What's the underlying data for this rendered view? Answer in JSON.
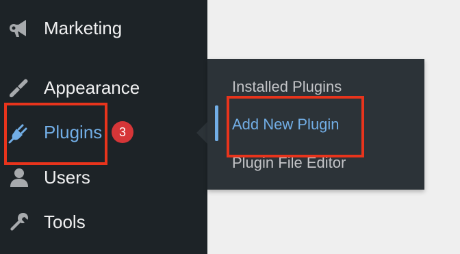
{
  "sidebar": {
    "items": [
      {
        "label": "Marketing",
        "icon": "megaphone-icon"
      },
      {
        "label": "Appearance",
        "icon": "paintbrush-icon"
      },
      {
        "label": "Plugins",
        "icon": "plugin-plug-icon",
        "badge": "3",
        "active": true
      },
      {
        "label": "Users",
        "icon": "user-icon"
      },
      {
        "label": "Tools",
        "icon": "wrench-icon"
      }
    ]
  },
  "submenu": {
    "items": [
      {
        "label": "Installed Plugins"
      },
      {
        "label": "Add New Plugin",
        "current": true
      },
      {
        "label": "Plugin File Editor"
      }
    ]
  },
  "colors": {
    "sidebar_bg": "#1d2327",
    "submenu_bg": "#2c3338",
    "accent": "#72aee6",
    "badge": "#d63638",
    "highlight": "#e8341c"
  }
}
